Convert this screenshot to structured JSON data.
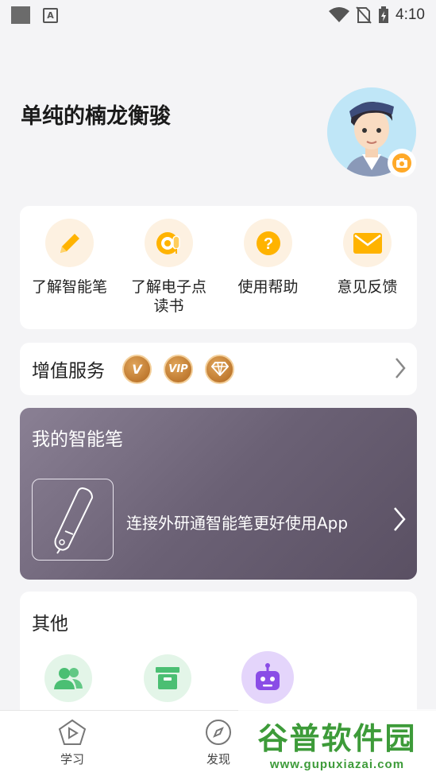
{
  "status_bar": {
    "time": "4:10",
    "icons": [
      "notification-square-icon",
      "a-icon",
      "wifi-icon",
      "no-sim-icon",
      "battery-charging-icon"
    ]
  },
  "profile": {
    "name": "单纯的楠龙衡骏",
    "avatar_icon": "avatar-image",
    "camera_icon": "camera-icon"
  },
  "quick_actions": [
    {
      "label": "了解智能笔",
      "icon": "pencil-icon"
    },
    {
      "label": "了解电子点读书",
      "icon": "audio-disc-icon"
    },
    {
      "label": "使用帮助",
      "icon": "question-icon"
    },
    {
      "label": "意见反馈",
      "icon": "mail-icon"
    }
  ],
  "vip": {
    "title": "增值服务",
    "badges": [
      "V",
      "VIP",
      "diamond"
    ]
  },
  "pen": {
    "title": "我的智能笔",
    "connect_text": "连接外研通智能笔更好使用App"
  },
  "other": {
    "title": "其他",
    "icons": [
      "group-icon",
      "box-icon",
      "robot-icon"
    ]
  },
  "tabs": [
    {
      "label": "学习",
      "icon": "play-pentagon-icon"
    },
    {
      "label": "发现",
      "icon": "compass-icon"
    }
  ],
  "watermark": {
    "logo": "谷普软件园",
    "url": "www.gupuxiazai.com"
  },
  "colors": {
    "accent_orange": "#ffb300",
    "icon_bg": "#fdf1e1",
    "pen_card": "#6b6175",
    "green": "#4bbf73"
  }
}
